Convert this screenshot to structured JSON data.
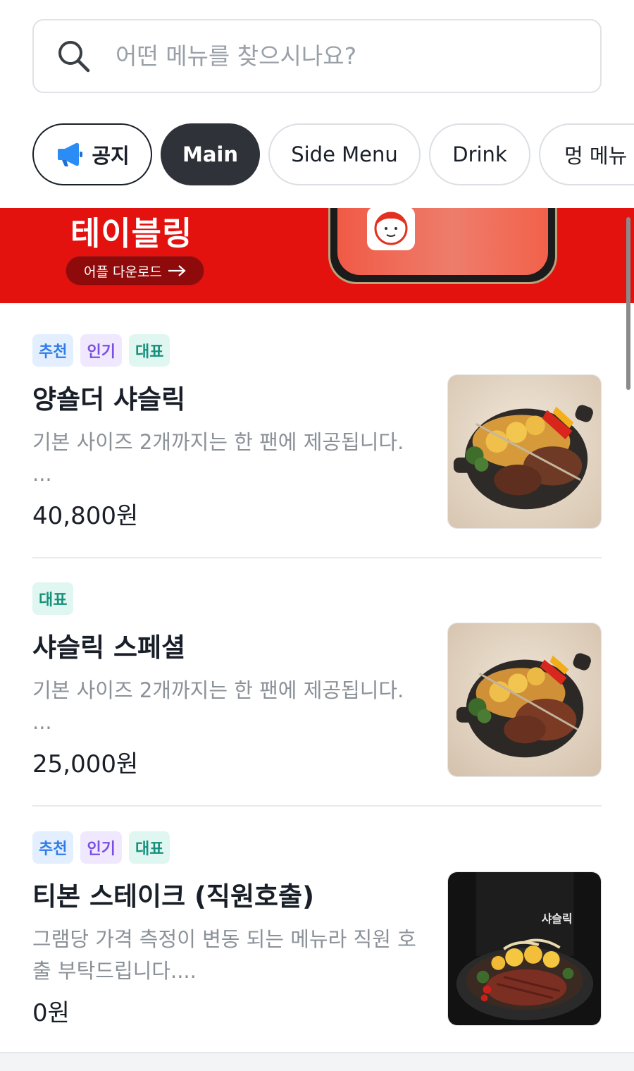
{
  "search": {
    "placeholder": "어떤 메뉴를 찾으시나요?"
  },
  "categories": [
    {
      "label": "공지",
      "icon": "megaphone-icon",
      "selected": false
    },
    {
      "label": "Main",
      "selected": true
    },
    {
      "label": "Side Menu",
      "selected": false
    },
    {
      "label": "Drink",
      "selected": false
    },
    {
      "label": "멍 메뉴",
      "selected": false
    }
  ],
  "banner": {
    "title": "테이블링",
    "download_label": "어플 다운로드",
    "background_color": "#e3120f"
  },
  "menu_items": [
    {
      "tags": [
        "추천",
        "인기",
        "대표"
      ],
      "name": "양숄더 샤슬릭",
      "description": "기본 사이즈 2개까지는 한 팬에 제공됩니다.\n...",
      "price": "40,800원"
    },
    {
      "tags": [
        "대표"
      ],
      "name": "샤슬릭 스페셜",
      "description": "기본 사이즈 2개까지는 한 팬에 제공됩니다.\n...",
      "price": "25,000원"
    },
    {
      "tags": [
        "추천",
        "인기",
        "대표"
      ],
      "name": "티본 스테이크 (직원호출)",
      "description": "그램당 가격 측정이 변동 되는 메뉴라 직원 호출 부탁드립니다....",
      "price": "0원",
      "image_text": "샤슬릭"
    }
  ],
  "colors": {
    "tag_recommend": "#2f7de8",
    "tag_popular": "#7b4fe2",
    "tag_signature": "#17917c",
    "chip_active_bg": "#2f3339"
  }
}
